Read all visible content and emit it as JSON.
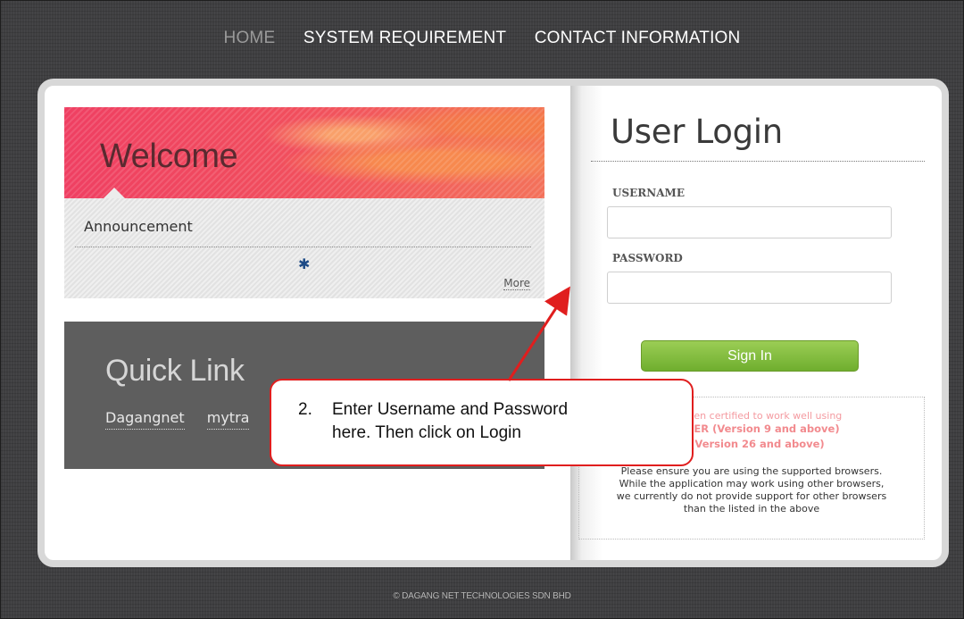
{
  "nav": {
    "home": "HOME",
    "system_requirement": "SYSTEM REQUIREMENT",
    "contact_information": "CONTACT INFORMATION"
  },
  "welcome": {
    "title": "Welcome",
    "announcement_title": "Announcement",
    "loading_icon": "spinner-icon",
    "more_label": "More"
  },
  "quick_link": {
    "title": "Quick Link",
    "links": [
      "Dagangnet",
      "mytra"
    ]
  },
  "login": {
    "title": "User Login",
    "username_label": "USERNAME",
    "username_value": "",
    "password_label": "PASSWORD",
    "password_value": "",
    "signin_label": "Sign In"
  },
  "notice": {
    "pink_line": "has been certified to work well using",
    "browser1": "PLORER (Version 9 and above)",
    "browser2": "X (Version 26 and above)",
    "body": [
      "Please ensure you are using the supported browsers.",
      "While the application may work using other browsers,",
      "we currently do not provide support for other browsers",
      "than the listed in the above"
    ]
  },
  "callout": {
    "number": "2.",
    "line1": "Enter Username and Password",
    "line2": "here. Then click on Login"
  },
  "footer": "© DAGANG NET TECHNOLOGIES SDN BHD",
  "colors": {
    "callout_border": "#e01e1e",
    "signin_green": "#7fbf3a",
    "banner_red": "#ef3f62",
    "quick_bg": "#5e5e5e"
  }
}
